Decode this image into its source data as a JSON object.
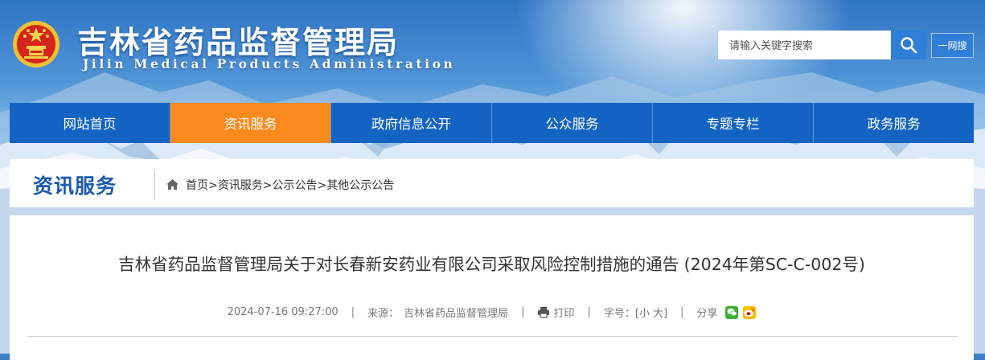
{
  "header": {
    "title": "吉林省药品监督管理局",
    "subtitle": "Jilin Medical Products Administration",
    "search_placeholder": "请输入关键字搜索",
    "oneweb_label": "一网搜"
  },
  "nav": {
    "items": [
      {
        "label": "网站首页",
        "active": false
      },
      {
        "label": "资讯服务",
        "active": true
      },
      {
        "label": "政府信息公开",
        "active": false
      },
      {
        "label": "公众服务",
        "active": false
      },
      {
        "label": "专题专栏",
        "active": false
      },
      {
        "label": "政务服务",
        "active": false
      }
    ],
    "active_color": "#fb8a1d",
    "bg_color": "#1364c2"
  },
  "section": {
    "title": "资讯服务",
    "breadcrumb": [
      "首页",
      "资讯服务",
      "公示公告",
      "其他公示公告"
    ],
    "breadcrumb_sep": ">"
  },
  "article": {
    "title": "吉林省药品监督管理局关于对长春新安药业有限公司采取风险控制措施的通告 (2024年第SC-C-002号)",
    "datetime": "2024-07-16 09:27:00",
    "source_label": "来源：",
    "source": "吉林省药品监督管理局",
    "print_label": "打印",
    "font_size_label": "字号：",
    "font_small": "[小",
    "font_large": "大]",
    "share_label": "分享",
    "sep": "|"
  },
  "icons": {
    "search": "search-icon",
    "home": "home-icon",
    "print": "printer-icon",
    "wechat": "wechat-icon",
    "weibo": "weibo-icon",
    "emblem": "national-emblem-icon"
  }
}
